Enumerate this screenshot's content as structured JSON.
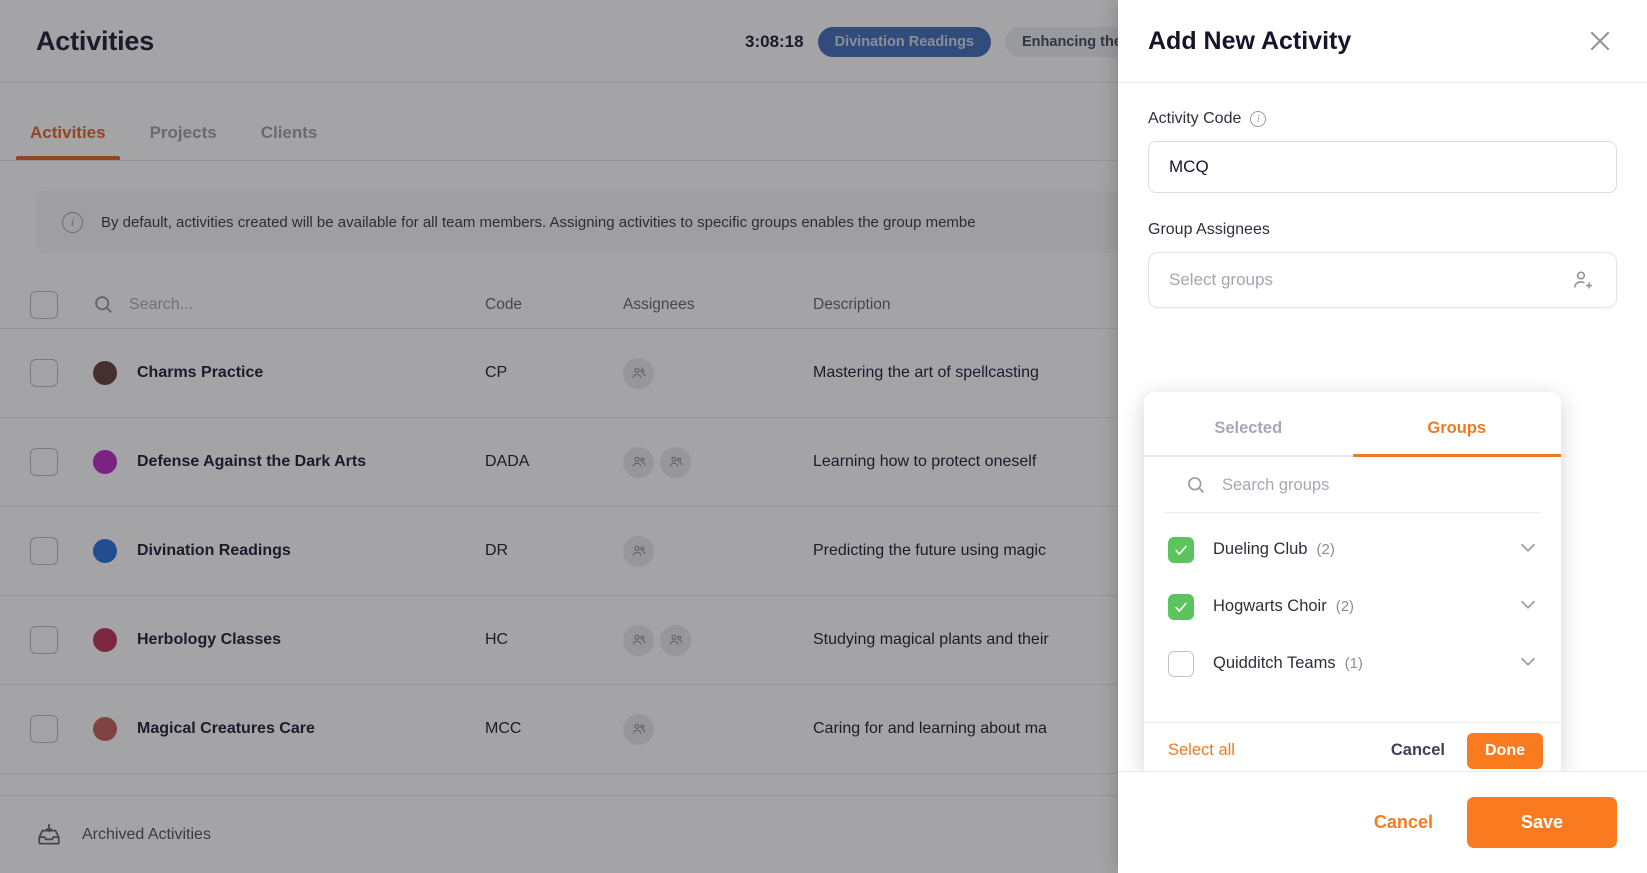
{
  "header": {
    "title": "Activities",
    "timer": "3:08:18",
    "active_badge": "Divination Readings",
    "secondary_badge": "Enhancing the J"
  },
  "tabs": [
    {
      "label": "Activities",
      "active": true
    },
    {
      "label": "Projects",
      "active": false
    },
    {
      "label": "Clients",
      "active": false
    }
  ],
  "notice": {
    "icon": "info-icon",
    "text": "By default, activities created will be available for all team members. Assigning activities to specific groups enables the group membe"
  },
  "table": {
    "search_placeholder": "Search...",
    "columns": [
      "Code",
      "Assignees",
      "Description"
    ],
    "rows": [
      {
        "name": "Charms Practice",
        "color": "#5b3a32",
        "code": "CP",
        "assignees": 1,
        "description": "Mastering the art of spellcasting"
      },
      {
        "name": "Defense Against the Dark Arts",
        "color": "#b81fc2",
        "code": "DADA",
        "assignees": 2,
        "description": "Learning how to protect oneself"
      },
      {
        "name": "Divination Readings",
        "color": "#2069d6",
        "code": "DR",
        "assignees": 1,
        "description": "Predicting the future using magic"
      },
      {
        "name": "Herbology Classes",
        "color": "#bc2a52",
        "code": "HC",
        "assignees": 2,
        "description": "Studying magical plants and their"
      },
      {
        "name": "Magical Creatures Care",
        "color": "#c05a52",
        "code": "MCC",
        "assignees": 1,
        "description": "Caring for and learning about ma"
      }
    ]
  },
  "footer": {
    "archived_label": "Archived Activities",
    "archived_icon": "archive-icon"
  },
  "modal": {
    "title": "Add New Activity",
    "close_icon": "close-icon",
    "activity_code": {
      "label": "Activity Code",
      "info_icon": "info-icon",
      "value": "MCQ"
    },
    "group_assignees": {
      "label": "Group Assignees",
      "placeholder": "Select groups",
      "icon": "add-person-icon"
    },
    "dropdown": {
      "tabs": [
        {
          "label": "Selected",
          "active": false
        },
        {
          "label": "Groups",
          "active": true
        }
      ],
      "search_placeholder": "Search groups",
      "search_icon": "search-icon",
      "items": [
        {
          "label": "Dueling Club",
          "count": "(2)",
          "checked": true,
          "chevron": "chevron-down-icon"
        },
        {
          "label": "Hogwarts Choir",
          "count": "(2)",
          "checked": true,
          "chevron": "chevron-down-icon"
        },
        {
          "label": "Quidditch Teams",
          "count": "(1)",
          "checked": false,
          "chevron": "chevron-down-icon"
        }
      ],
      "select_all_label": "Select all",
      "cancel_label": "Cancel",
      "done_label": "Done"
    },
    "color_swatches": [
      "#7c3aed",
      "#3b82f6",
      "#5b3a2a",
      "#8b6b5a",
      "#b6a49b",
      "#4caf67"
    ],
    "cancel_label": "Cancel",
    "save_label": "Save"
  },
  "colors": {
    "accent_orange": "#f97a1f",
    "tab_orange": "#d9601c",
    "badge_blue": "#3a66b5",
    "check_green": "#5bc45f"
  }
}
